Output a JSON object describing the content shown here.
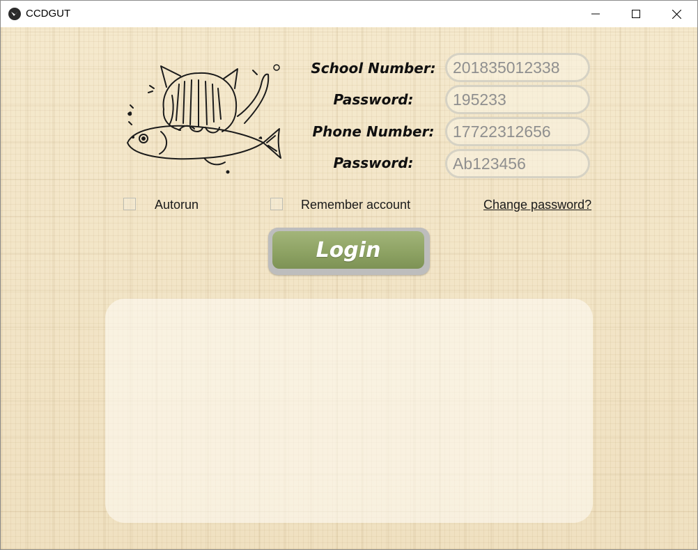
{
  "window": {
    "title": "CCDGUT",
    "app_icon": "kivy-logo-icon",
    "controls": [
      "minimize-icon",
      "maximize-icon",
      "close-icon"
    ]
  },
  "form": {
    "fields": [
      {
        "label": "School Number:",
        "value": "201835012338"
      },
      {
        "label": "Password:",
        "value": "195233"
      },
      {
        "label": "Phone Number:",
        "value": "17722312656"
      },
      {
        "label": "Password:",
        "value": "Ab123456"
      }
    ],
    "autorun": {
      "label": "Autorun",
      "checked": false
    },
    "remember": {
      "label": "Remember account",
      "checked": false
    },
    "change_password_link": "Change password?",
    "login_button": "Login"
  },
  "colors": {
    "background": "#f3e6c9",
    "login_button": "#8ea364",
    "field_border": "#d6d2c4",
    "field_text": "#8f8f8f"
  }
}
